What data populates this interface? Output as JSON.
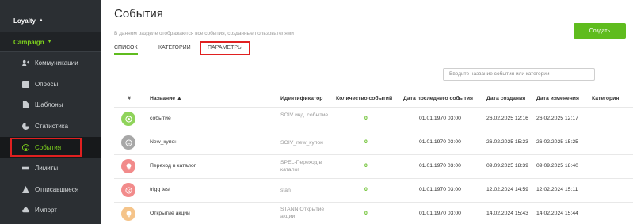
{
  "sidebar": {
    "groups": [
      {
        "label": "Loyalty",
        "state": "collapsed"
      },
      {
        "label": "Campaign",
        "state": "expanded"
      }
    ],
    "items": [
      {
        "label": "Коммуникации",
        "icon": "megaphone-icon"
      },
      {
        "label": "Опросы",
        "icon": "survey-icon"
      },
      {
        "label": "Шаблоны",
        "icon": "document-icon"
      },
      {
        "label": "Статистика",
        "icon": "pie-chart-icon"
      },
      {
        "label": "События",
        "icon": "smile-icon",
        "active": true
      },
      {
        "label": "Лимиты",
        "icon": "bar-limits-icon"
      },
      {
        "label": "Отписавшиеся",
        "icon": "unsubscribe-icon"
      },
      {
        "label": "Импорт",
        "icon": "cloud-upload-icon"
      }
    ]
  },
  "header": {
    "title": "События",
    "subtitle": "В данном разделе отображаются все события, созданные пользователями",
    "create_label": "Создать"
  },
  "tabs": [
    {
      "label": "СПИСОК",
      "active": true
    },
    {
      "label": "КАТЕГОРИИ"
    },
    {
      "label": "ПАРАМЕТРЫ"
    }
  ],
  "search": {
    "placeholder": "Введите название события или категории"
  },
  "table": {
    "columns": [
      "#",
      "Название ▲",
      "Идентификатор",
      "Количество событий",
      "Дата последнего события",
      "Дата создания",
      "Дата изменения",
      "Категория"
    ],
    "rows": [
      {
        "icon": "target-icon",
        "color": "#8fd35a",
        "name": "событие",
        "id": "SOIV инд. событие",
        "count": "0",
        "last": "01.01.1970 03:00",
        "created": "26.02.2025 12:16",
        "changed": "26.02.2025 12:17"
      },
      {
        "icon": "neutral-face-icon",
        "color": "#a7a7a7",
        "name": "New_купон",
        "id": "SOIV_new_купон",
        "count": "0",
        "last": "01.01.1970 03:00",
        "created": "26.02.2025 15:23",
        "changed": "26.02.2025 15:25"
      },
      {
        "icon": "lightbulb-icon",
        "color": "#f28b8b",
        "name": "Переход в каталог",
        "id": "SPEL-Переход в каталог",
        "count": "0",
        "last": "01.01.1970 03:00",
        "created": "09.09.2025 18:39",
        "changed": "09.09.2025 18:40"
      },
      {
        "icon": "sad-face-icon",
        "color": "#f28b8b",
        "name": "trigg test",
        "id": "stan",
        "count": "0",
        "last": "01.01.1970 03:00",
        "created": "12.02.2024 14:59",
        "changed": "12.02.2024 15:11"
      },
      {
        "icon": "lightbulb-icon",
        "color": "#f5c48a",
        "name": "Открытие акции",
        "id": "STANN Открытие акции",
        "count": "0",
        "last": "01.01.1970 03:00",
        "created": "14.02.2024 15:43",
        "changed": "14.02.2024 15:44"
      }
    ]
  }
}
